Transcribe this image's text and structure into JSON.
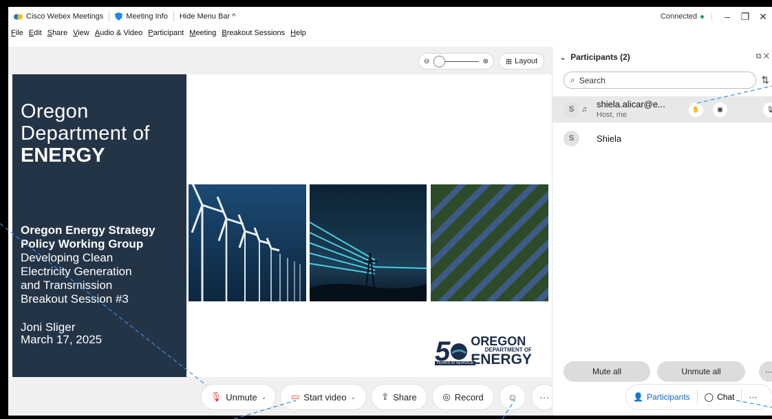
{
  "titlebar": {
    "app_name": "Cisco Webex Meetings",
    "meeting_info": "Meeting Info",
    "hide_menu": "Hide Menu Bar ^",
    "connection_status": "Connected",
    "colors": {
      "connected": "#1f9d55"
    }
  },
  "menubar": {
    "items": [
      "File",
      "Edit",
      "Share",
      "View",
      "Audio & Video",
      "Participant",
      "Meeting",
      "Breakout Sessions",
      "Help"
    ]
  },
  "stage": {
    "zoom_out_icon": "zoom-out-icon",
    "zoom_in_icon": "zoom-in-icon",
    "layout_label": "Layout"
  },
  "slide": {
    "org_line1": "Oregon",
    "org_line2": "Department of",
    "org_line3": "ENERGY",
    "group_line1": "Oregon Energy Strategy",
    "group_line2": "Policy Working Group",
    "desc_line1": "Developing Clean",
    "desc_line2": "Electricity Generation",
    "desc_line3": "and Transmission",
    "desc_line4": "Breakout Session #3",
    "presenter": "Joni Sliger",
    "date": "March 17, 2025",
    "logo": {
      "number": "5",
      "oregon": "OREGON",
      "dept": "DEPARTMENT OF",
      "energy": "ENERGY",
      "years": "YEARS of SERVICE"
    },
    "colors": {
      "panel": "#243447",
      "logo": "#1b2c4b"
    }
  },
  "controls": {
    "unmute": "Unmute",
    "start_video": "Start video",
    "share": "Share",
    "record": "Record",
    "more": "···",
    "end": "✕",
    "colors": {
      "end": "#e5372a"
    }
  },
  "participants_panel": {
    "title": "Participants (2)",
    "search_placeholder": "Search",
    "participants": [
      {
        "initial": "S",
        "name": "shiela.alicar@e...",
        "role": "Host, me"
      },
      {
        "initial": "S",
        "name": "Shiela",
        "role": ""
      }
    ],
    "mute_all": "Mute all",
    "unmute_all": "Unmute all",
    "more": "···"
  },
  "tabs": {
    "participants": "Participants",
    "chat": "Chat",
    "more": "···",
    "colors": {
      "active": "#1565c0"
    }
  }
}
